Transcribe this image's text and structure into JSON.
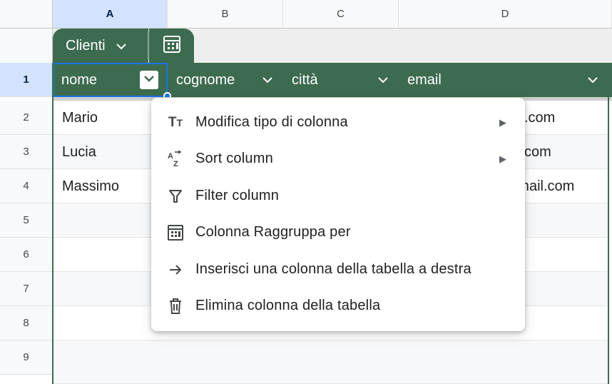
{
  "column_headers": [
    "A",
    "B",
    "C",
    "D"
  ],
  "selected_column": "A",
  "table": {
    "name": "Clienti",
    "columns": [
      "nome",
      "cognome",
      "città",
      "email"
    ]
  },
  "row_numbers": [
    "1",
    "2",
    "3",
    "4",
    "5",
    "6",
    "7",
    "8",
    "9"
  ],
  "rows": [
    {
      "nome": "Mario",
      "email_partial": ".com"
    },
    {
      "nome": "Lucia",
      "email_partial": "com"
    },
    {
      "nome": "Massimo",
      "email_partial": "@mail.com"
    }
  ],
  "context_menu": {
    "items": [
      {
        "label": "Modifica tipo di colonna",
        "icon": "text-type-icon",
        "submenu": true
      },
      {
        "label": "Sort column",
        "icon": "sort-az-icon",
        "submenu": true
      },
      {
        "label": "Filter column",
        "icon": "filter-icon",
        "submenu": false
      },
      {
        "label": "Colonna Raggruppa per",
        "icon": "group-by-icon",
        "submenu": false
      },
      {
        "label": "Inserisci una colonna della tabella a destra",
        "icon": "arrow-right-icon",
        "submenu": false
      },
      {
        "label": "Elimina colonna della tabella",
        "icon": "trash-icon",
        "submenu": false
      }
    ]
  },
  "colors": {
    "table_header": "#3d6b4f",
    "selection": "#1a73e8",
    "selected_header_bg": "#d3e3fd"
  }
}
